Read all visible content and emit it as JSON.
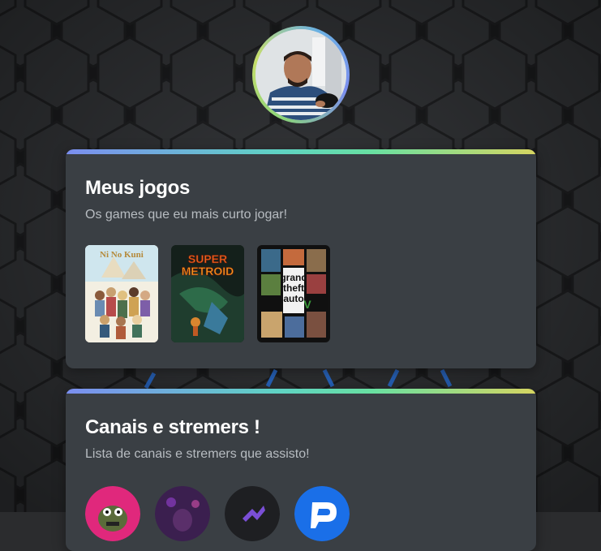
{
  "profile": {
    "avatar_alt": "profile-photo"
  },
  "games_section": {
    "title": "Meus jogos",
    "subtitle": "Os games que eu mais curto jogar!",
    "games": [
      {
        "name": "Ni no Kuni",
        "icon": "ni-no-kuni-cover"
      },
      {
        "name": "Super Metroid",
        "icon": "super-metroid-cover",
        "logo_line1": "SUPER",
        "logo_line2": "METROID"
      },
      {
        "name": "Grand Theft Auto V",
        "icon": "gta-v-cover",
        "logo_line1": "grand",
        "logo_line2": "theft",
        "logo_line3": "auto",
        "logo_v": "V"
      }
    ]
  },
  "channels_section": {
    "title": "Canais e stremers !",
    "subtitle": "Lista de canais e stremers que assisto!",
    "channels": [
      {
        "icon": "channel-1-avatar",
        "color": "#e0287c"
      },
      {
        "icon": "channel-2-avatar",
        "color": "#3b1f4f"
      },
      {
        "icon": "channel-3-avatar",
        "color": "#1e1f22"
      },
      {
        "icon": "channel-4-avatar",
        "color": "#1a6fe8"
      }
    ]
  },
  "colors": {
    "card_bg": "#3a3f44",
    "gradient_start": "#7b8ef0",
    "gradient_mid": "#68e0a2",
    "gradient_end": "#d6d561",
    "title": "#ffffff",
    "subtitle": "#b7bcc1"
  }
}
